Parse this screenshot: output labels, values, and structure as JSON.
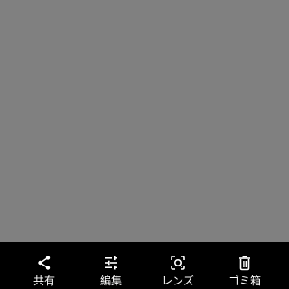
{
  "colors": {
    "photo_background": "#808080",
    "bar_background": "#000000",
    "icon_color": "#ffffff",
    "label_color": "#ffffff"
  },
  "bottom_bar": {
    "items": [
      {
        "label": "共有",
        "icon": "share-icon"
      },
      {
        "label": "編集",
        "icon": "tune-sliders-icon"
      },
      {
        "label": "レンズ",
        "icon": "lens-icon"
      },
      {
        "label": "ゴミ箱",
        "icon": "trash-icon"
      }
    ]
  }
}
